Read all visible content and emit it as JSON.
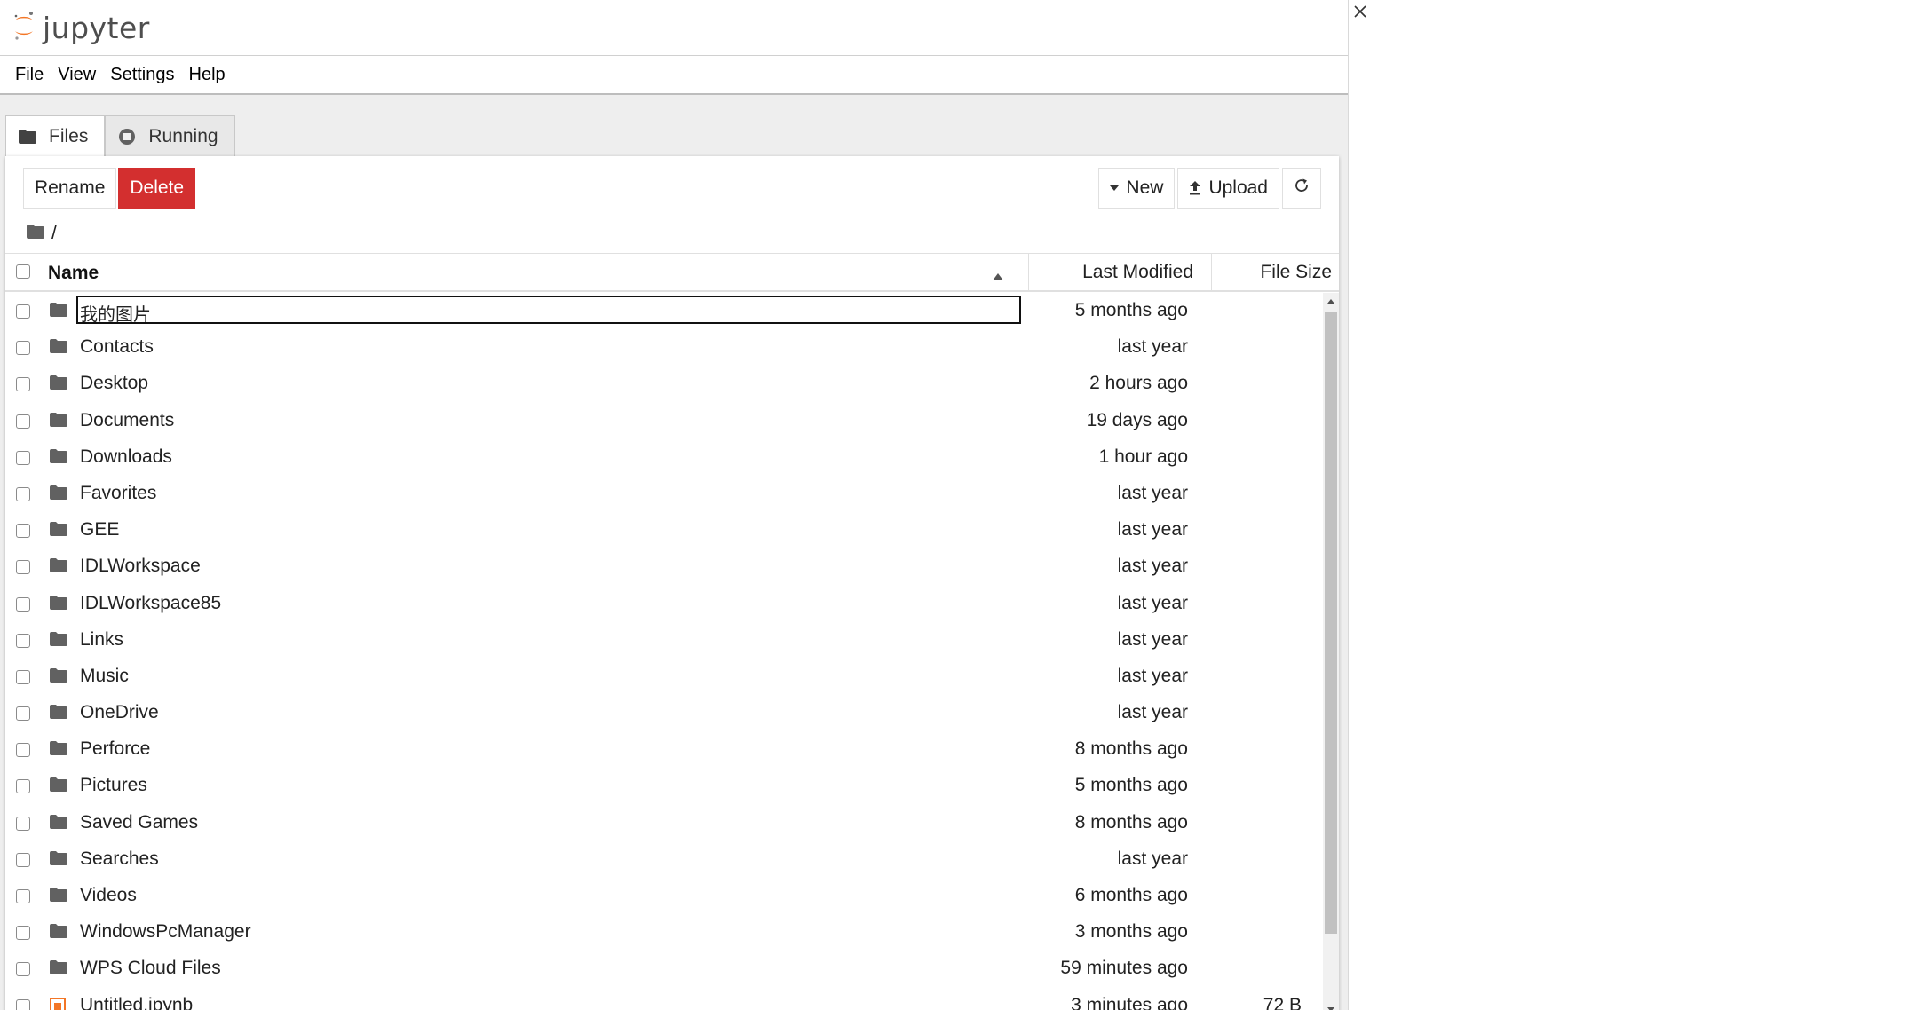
{
  "brand": {
    "name": "jupyter"
  },
  "menu": [
    "File",
    "View",
    "Settings",
    "Help"
  ],
  "tabs": [
    {
      "label": "Files",
      "icon": "folder-icon",
      "active": true
    },
    {
      "label": "Running",
      "icon": "running-icon",
      "active": false
    }
  ],
  "toolbar": {
    "rename_label": "Rename",
    "delete_label": "Delete",
    "new_label": "New",
    "upload_label": "Upload",
    "refresh_icon": "refresh-icon"
  },
  "breadcrumb": {
    "path": "/"
  },
  "list_header": {
    "name": "Name",
    "last_modified": "Last Modified",
    "file_size": "File Size",
    "sort": "ascending"
  },
  "files": [
    {
      "name": "我的图片",
      "modified": "5 months ago",
      "size": "",
      "type": "folder",
      "editing": true
    },
    {
      "name": "Contacts",
      "modified": "last year",
      "size": "",
      "type": "folder"
    },
    {
      "name": "Desktop",
      "modified": "2 hours ago",
      "size": "",
      "type": "folder"
    },
    {
      "name": "Documents",
      "modified": "19 days ago",
      "size": "",
      "type": "folder"
    },
    {
      "name": "Downloads",
      "modified": "1 hour ago",
      "size": "",
      "type": "folder"
    },
    {
      "name": "Favorites",
      "modified": "last year",
      "size": "",
      "type": "folder"
    },
    {
      "name": "GEE",
      "modified": "last year",
      "size": "",
      "type": "folder"
    },
    {
      "name": "IDLWorkspace",
      "modified": "last year",
      "size": "",
      "type": "folder"
    },
    {
      "name": "IDLWorkspace85",
      "modified": "last year",
      "size": "",
      "type": "folder"
    },
    {
      "name": "Links",
      "modified": "last year",
      "size": "",
      "type": "folder"
    },
    {
      "name": "Music",
      "modified": "last year",
      "size": "",
      "type": "folder"
    },
    {
      "name": "OneDrive",
      "modified": "last year",
      "size": "",
      "type": "folder"
    },
    {
      "name": "Perforce",
      "modified": "8 months ago",
      "size": "",
      "type": "folder"
    },
    {
      "name": "Pictures",
      "modified": "5 months ago",
      "size": "",
      "type": "folder"
    },
    {
      "name": "Saved Games",
      "modified": "8 months ago",
      "size": "",
      "type": "folder"
    },
    {
      "name": "Searches",
      "modified": "last year",
      "size": "",
      "type": "folder"
    },
    {
      "name": "Videos",
      "modified": "6 months ago",
      "size": "",
      "type": "folder"
    },
    {
      "name": "WindowsPcManager",
      "modified": "3 months ago",
      "size": "",
      "type": "folder"
    },
    {
      "name": "WPS Cloud Files",
      "modified": "59 minutes ago",
      "size": "",
      "type": "folder"
    },
    {
      "name": "Untitled.ipynb",
      "modified": "3 minutes ago",
      "size": "72 B",
      "type": "notebook"
    }
  ],
  "colors": {
    "accent_orange": "#f37626",
    "danger": "#d32f2f",
    "folder": "#616161"
  }
}
